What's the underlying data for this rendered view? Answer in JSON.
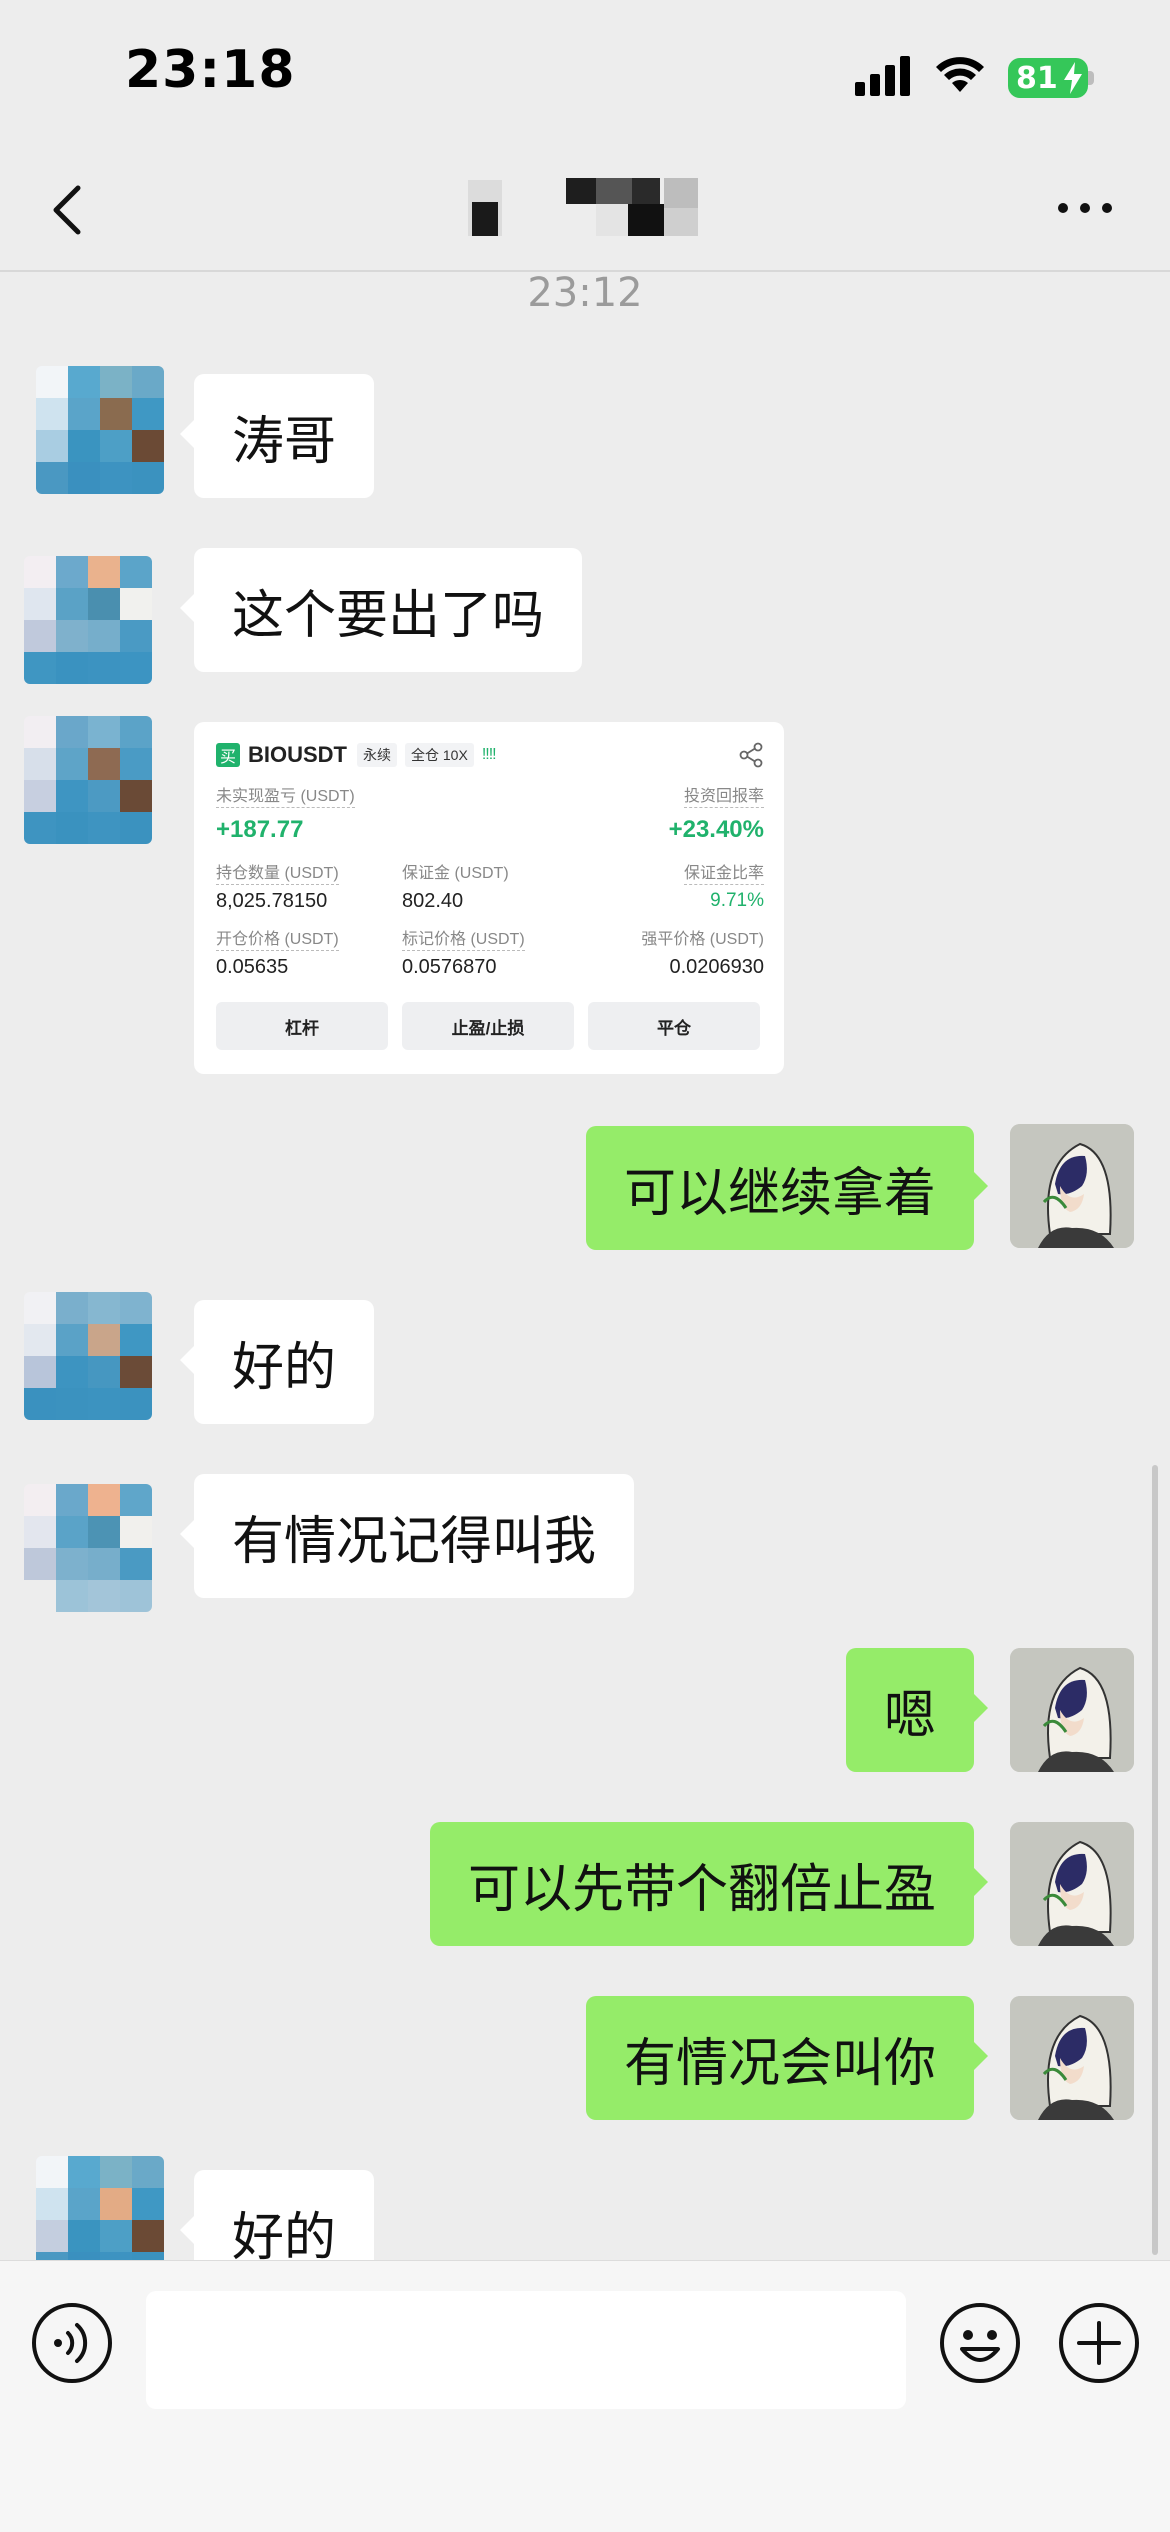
{
  "status_bar": {
    "time": "23:18",
    "battery_level": "81",
    "battery_color": "#35c759"
  },
  "nav": {
    "title": "",
    "back_icon": "chevron-left-icon",
    "more_icon": "ellipsis-icon"
  },
  "chat": {
    "time_separator": "23:12",
    "messages": [
      {
        "side": "in",
        "text": "涛哥"
      },
      {
        "side": "in",
        "text": "这个要出了吗"
      },
      {
        "side": "in",
        "type": "image"
      },
      {
        "side": "out",
        "text": "可以继续拿着"
      },
      {
        "side": "in",
        "text": "好的"
      },
      {
        "side": "in",
        "text": "有情况记得叫我"
      },
      {
        "side": "out",
        "text": "嗯"
      },
      {
        "side": "out",
        "text": "可以先带个翻倍止盈"
      },
      {
        "side": "out",
        "text": "有情况会叫你"
      },
      {
        "side": "in",
        "text": "好的"
      }
    ]
  },
  "trade_card": {
    "buy_badge": "买",
    "symbol": "BIOUSDT",
    "tag_perpetual": "永续",
    "tag_margin": "全仓 10X",
    "bars": "!!!!",
    "unrealized_pnl_label": "未实现盈亏 (USDT)",
    "unrealized_pnl_value": "+187.77",
    "roi_label": "投资回报率",
    "roi_value": "+23.40%",
    "position_size_label": "持仓数量 (USDT)",
    "position_size_value": "8,025.78150",
    "margin_label": "保证金 (USDT)",
    "margin_value": "802.40",
    "margin_ratio_label": "保证金比率",
    "margin_ratio_value": "9.71%",
    "entry_price_label": "开仓价格 (USDT)",
    "entry_price_value": "0.05635",
    "mark_price_label": "标记价格 (USDT)",
    "mark_price_value": "0.0576870",
    "liq_price_label": "强平价格 (USDT)",
    "liq_price_value": "0.0206930",
    "btn_leverage": "杠杆",
    "btn_tpsl": "止盈/止损",
    "btn_close": "平仓",
    "accent_color": "#20b26c"
  },
  "input_bar": {
    "placeholder": "",
    "voice_icon": "voice-icon",
    "emoji_icon": "emoji-icon",
    "add_icon": "plus-circle-icon"
  },
  "colors": {
    "background": "#ededed",
    "out_bubble": "#95ec69",
    "in_bubble": "#ffffff"
  }
}
